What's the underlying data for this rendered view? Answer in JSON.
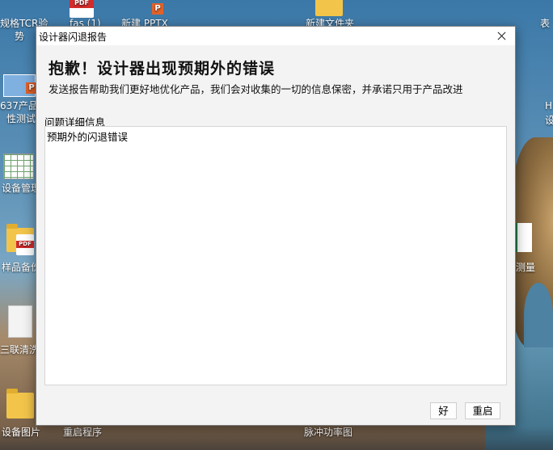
{
  "desktop": {
    "icons": [
      {
        "label": "规格TCR验",
        "label2": "势"
      },
      {
        "label": "fas (1)"
      },
      {
        "label": "新建 PPTX"
      },
      {
        "label": "新建文件夹"
      },
      {
        "label": "637产品",
        "label2": "性测试"
      },
      {
        "label": "设备管理"
      },
      {
        "label": "样品备份"
      },
      {
        "label": "三联清洗"
      },
      {
        "label": "设备图片"
      },
      {
        "label": "重启程序"
      },
      {
        "label": "脉冲功率图"
      },
      {
        "label": "测量"
      },
      {
        "label": "H",
        "label2": "设"
      },
      {
        "label": "表"
      }
    ]
  },
  "dialog": {
    "title": "设计器闪退报告",
    "headline": "抱歉！设计器出现预期外的错误",
    "subline": "发送报告帮助我们更好地优化产品，我们会对收集的一切的信息保密，并承诺只用于产品改进",
    "detail_label": "问题详细信息",
    "detail_text": "预期外的闪退错误",
    "ok_label": "好",
    "restart_label": "重启"
  }
}
